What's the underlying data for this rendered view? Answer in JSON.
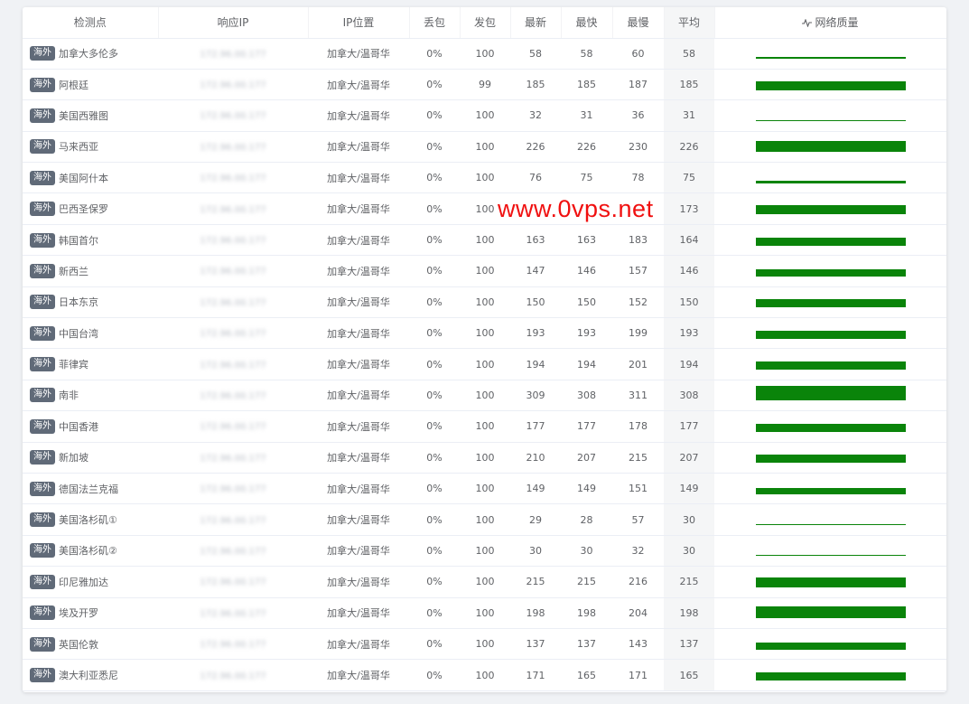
{
  "headers": {
    "node": "检测点",
    "ip": "响应IP",
    "location": "IP位置",
    "loss": "丢包",
    "sent": "发包",
    "latest": "最新",
    "fastest": "最快",
    "slowest": "最慢",
    "avg": "平均",
    "quality": "网络质量",
    "quality_icon": "activity-icon"
  },
  "watermark": "www.0vps.net",
  "bar_color": "#0a840a",
  "rows": [
    {
      "tag": "海外",
      "node": "加拿大多伦多",
      "ip": "172.96.00.177",
      "location": "加拿大/温哥华",
      "loss": "0%",
      "sent": "100",
      "latest": "58",
      "fastest": "58",
      "slowest": "60",
      "avg": "58"
    },
    {
      "tag": "海外",
      "node": "阿根廷",
      "ip": "172.96.00.177",
      "location": "加拿大/温哥华",
      "loss": "0%",
      "sent": "99",
      "latest": "185",
      "fastest": "185",
      "slowest": "187",
      "avg": "185"
    },
    {
      "tag": "海外",
      "node": "美国西雅图",
      "ip": "172.96.00.177",
      "location": "加拿大/温哥华",
      "loss": "0%",
      "sent": "100",
      "latest": "32",
      "fastest": "31",
      "slowest": "36",
      "avg": "31"
    },
    {
      "tag": "海外",
      "node": "马来西亚",
      "ip": "172.96.00.177",
      "location": "加拿大/温哥华",
      "loss": "0%",
      "sent": "100",
      "latest": "226",
      "fastest": "226",
      "slowest": "230",
      "avg": "226"
    },
    {
      "tag": "海外",
      "node": "美国阿什本",
      "ip": "172.96.00.177",
      "location": "加拿大/温哥华",
      "loss": "0%",
      "sent": "100",
      "latest": "76",
      "fastest": "75",
      "slowest": "78",
      "avg": "75"
    },
    {
      "tag": "海外",
      "node": "巴西圣保罗",
      "ip": "172.96.00.177",
      "location": "加拿大/温哥华",
      "loss": "0%",
      "sent": "100",
      "latest": "",
      "fastest": "",
      "slowest": "",
      "avg": "173"
    },
    {
      "tag": "海外",
      "node": "韩国首尔",
      "ip": "172.96.00.177",
      "location": "加拿大/温哥华",
      "loss": "0%",
      "sent": "100",
      "latest": "163",
      "fastest": "163",
      "slowest": "183",
      "avg": "164"
    },
    {
      "tag": "海外",
      "node": "新西兰",
      "ip": "172.96.00.177",
      "location": "加拿大/温哥华",
      "loss": "0%",
      "sent": "100",
      "latest": "147",
      "fastest": "146",
      "slowest": "157",
      "avg": "146"
    },
    {
      "tag": "海外",
      "node": "日本东京",
      "ip": "172.96.00.177",
      "location": "加拿大/温哥华",
      "loss": "0%",
      "sent": "100",
      "latest": "150",
      "fastest": "150",
      "slowest": "152",
      "avg": "150"
    },
    {
      "tag": "海外",
      "node": "中国台湾",
      "ip": "172.96.00.177",
      "location": "加拿大/温哥华",
      "loss": "0%",
      "sent": "100",
      "latest": "193",
      "fastest": "193",
      "slowest": "199",
      "avg": "193"
    },
    {
      "tag": "海外",
      "node": "菲律宾",
      "ip": "172.96.00.177",
      "location": "加拿大/温哥华",
      "loss": "0%",
      "sent": "100",
      "latest": "194",
      "fastest": "194",
      "slowest": "201",
      "avg": "194"
    },
    {
      "tag": "海外",
      "node": "南非",
      "ip": "172.96.00.177",
      "location": "加拿大/温哥华",
      "loss": "0%",
      "sent": "100",
      "latest": "309",
      "fastest": "308",
      "slowest": "311",
      "avg": "308"
    },
    {
      "tag": "海外",
      "node": "中国香港",
      "ip": "172.96.00.177",
      "location": "加拿大/温哥华",
      "loss": "0%",
      "sent": "100",
      "latest": "177",
      "fastest": "177",
      "slowest": "178",
      "avg": "177"
    },
    {
      "tag": "海外",
      "node": "新加坡",
      "ip": "172.96.00.177",
      "location": "加拿大/温哥华",
      "loss": "0%",
      "sent": "100",
      "latest": "210",
      "fastest": "207",
      "slowest": "215",
      "avg": "207"
    },
    {
      "tag": "海外",
      "node": "德国法兰克福",
      "ip": "172.96.00.177",
      "location": "加拿大/温哥华",
      "loss": "0%",
      "sent": "100",
      "latest": "149",
      "fastest": "149",
      "slowest": "151",
      "avg": "149"
    },
    {
      "tag": "海外",
      "node": "美国洛杉矶①",
      "ip": "172.96.00.177",
      "location": "加拿大/温哥华",
      "loss": "0%",
      "sent": "100",
      "latest": "29",
      "fastest": "28",
      "slowest": "57",
      "avg": "30"
    },
    {
      "tag": "海外",
      "node": "美国洛杉矶②",
      "ip": "172.96.00.177",
      "location": "加拿大/温哥华",
      "loss": "0%",
      "sent": "100",
      "latest": "30",
      "fastest": "30",
      "slowest": "32",
      "avg": "30"
    },
    {
      "tag": "海外",
      "node": "印尼雅加达",
      "ip": "172.96.00.177",
      "location": "加拿大/温哥华",
      "loss": "0%",
      "sent": "100",
      "latest": "215",
      "fastest": "215",
      "slowest": "216",
      "avg": "215"
    },
    {
      "tag": "海外",
      "node": "埃及开罗",
      "ip": "172.96.00.177",
      "location": "加拿大/温哥华",
      "loss": "0%",
      "sent": "100",
      "latest": "198",
      "fastest": "198",
      "slowest": "204",
      "avg": "198"
    },
    {
      "tag": "海外",
      "node": "英国伦敦",
      "ip": "172.96.00.177",
      "location": "加拿大/温哥华",
      "loss": "0%",
      "sent": "100",
      "latest": "137",
      "fastest": "137",
      "slowest": "143",
      "avg": "137"
    },
    {
      "tag": "海外",
      "node": "澳大利亚悉尼",
      "ip": "172.96.00.177",
      "location": "加拿大/温哥华",
      "loss": "0%",
      "sent": "100",
      "latest": "171",
      "fastest": "165",
      "slowest": "171",
      "avg": "165"
    }
  ]
}
